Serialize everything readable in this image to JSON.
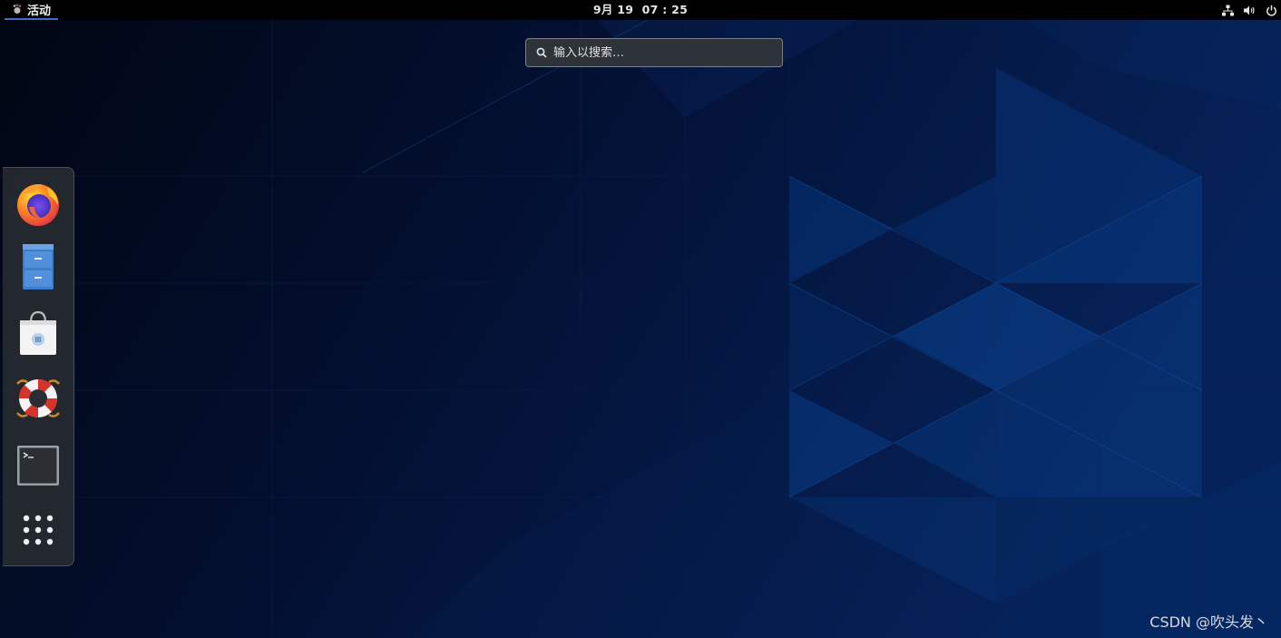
{
  "topbar": {
    "activities_label": "活动",
    "clock": "9月 19  07 : 25",
    "status_icons": [
      "network-icon",
      "volume-icon",
      "power-icon"
    ]
  },
  "search": {
    "placeholder": "输入以搜索…"
  },
  "dash": {
    "items": [
      {
        "name": "Firefox",
        "icon": "firefox-icon"
      },
      {
        "name": "Files",
        "icon": "file-cabinet-icon"
      },
      {
        "name": "Software",
        "icon": "shopping-bag-icon"
      },
      {
        "name": "Help",
        "icon": "lifebuoy-icon"
      },
      {
        "name": "Terminal",
        "icon": "terminal-icon"
      },
      {
        "name": "Show Applications",
        "icon": "app-grid-icon"
      }
    ]
  },
  "watermark": "CSDN @吹头发丶",
  "colors": {
    "topbar_bg": "#000000",
    "wallpaper_dark": "#02081c",
    "wallpaper_blue": "#0a3a7a",
    "dash_bg": "#262a30",
    "activities_underline": "#3c6ec8"
  }
}
